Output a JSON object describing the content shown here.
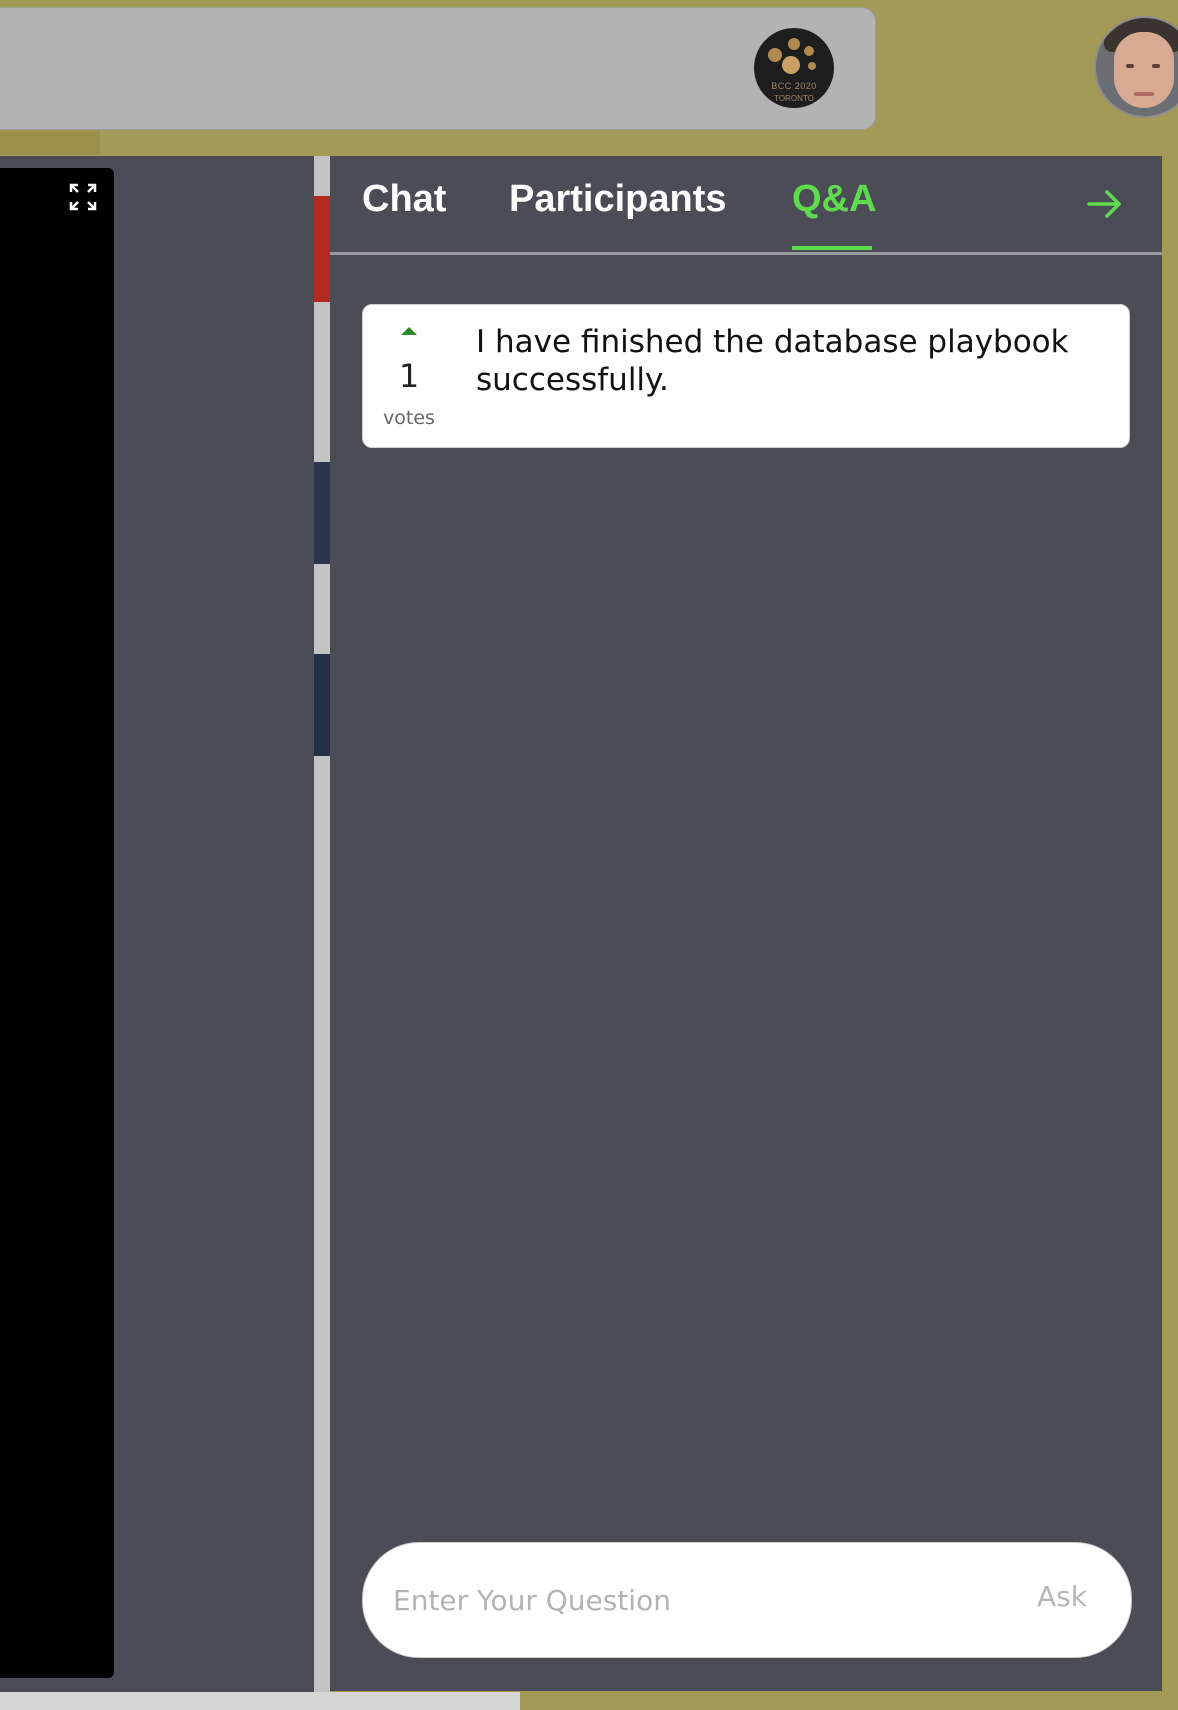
{
  "header": {
    "event_logo": {
      "icon": "event-logo",
      "text_line1": "BCC 2020",
      "text_line2": "TORONTO"
    },
    "user_avatar": {
      "icon": "user-avatar"
    }
  },
  "stage": {
    "expand_icon": "expand-icon"
  },
  "panel": {
    "tabs": [
      {
        "label": "Chat",
        "active": false
      },
      {
        "label": "Participants",
        "active": false
      },
      {
        "label": "Q&A",
        "active": true
      }
    ],
    "close_icon": "arrow-right-icon",
    "accent_color": "#5edc4e",
    "questions": [
      {
        "votes": "1",
        "votes_label": "votes",
        "text": "I have finished the database playbook successfully."
      }
    ],
    "ask": {
      "placeholder": "Enter Your Question",
      "button_label": "Ask"
    }
  }
}
